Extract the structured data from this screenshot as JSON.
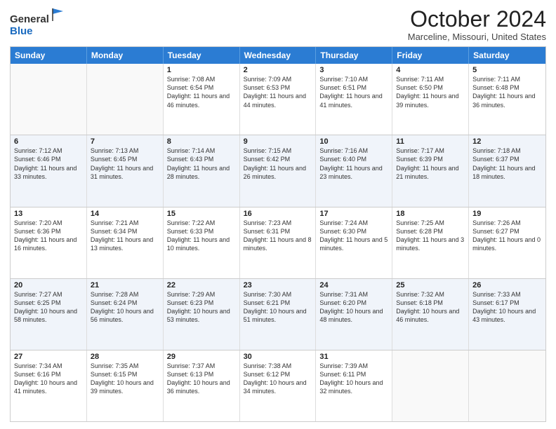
{
  "header": {
    "logo_line1": "General",
    "logo_line2": "Blue",
    "month_title": "October 2024",
    "location": "Marceline, Missouri, United States"
  },
  "weekdays": [
    "Sunday",
    "Monday",
    "Tuesday",
    "Wednesday",
    "Thursday",
    "Friday",
    "Saturday"
  ],
  "weeks": [
    [
      {
        "day": "",
        "info": "",
        "empty": true
      },
      {
        "day": "",
        "info": "",
        "empty": true
      },
      {
        "day": "1",
        "info": "Sunrise: 7:08 AM\nSunset: 6:54 PM\nDaylight: 11 hours and 46 minutes.",
        "empty": false
      },
      {
        "day": "2",
        "info": "Sunrise: 7:09 AM\nSunset: 6:53 PM\nDaylight: 11 hours and 44 minutes.",
        "empty": false
      },
      {
        "day": "3",
        "info": "Sunrise: 7:10 AM\nSunset: 6:51 PM\nDaylight: 11 hours and 41 minutes.",
        "empty": false
      },
      {
        "day": "4",
        "info": "Sunrise: 7:11 AM\nSunset: 6:50 PM\nDaylight: 11 hours and 39 minutes.",
        "empty": false
      },
      {
        "day": "5",
        "info": "Sunrise: 7:11 AM\nSunset: 6:48 PM\nDaylight: 11 hours and 36 minutes.",
        "empty": false
      }
    ],
    [
      {
        "day": "6",
        "info": "Sunrise: 7:12 AM\nSunset: 6:46 PM\nDaylight: 11 hours and 33 minutes.",
        "empty": false
      },
      {
        "day": "7",
        "info": "Sunrise: 7:13 AM\nSunset: 6:45 PM\nDaylight: 11 hours and 31 minutes.",
        "empty": false
      },
      {
        "day": "8",
        "info": "Sunrise: 7:14 AM\nSunset: 6:43 PM\nDaylight: 11 hours and 28 minutes.",
        "empty": false
      },
      {
        "day": "9",
        "info": "Sunrise: 7:15 AM\nSunset: 6:42 PM\nDaylight: 11 hours and 26 minutes.",
        "empty": false
      },
      {
        "day": "10",
        "info": "Sunrise: 7:16 AM\nSunset: 6:40 PM\nDaylight: 11 hours and 23 minutes.",
        "empty": false
      },
      {
        "day": "11",
        "info": "Sunrise: 7:17 AM\nSunset: 6:39 PM\nDaylight: 11 hours and 21 minutes.",
        "empty": false
      },
      {
        "day": "12",
        "info": "Sunrise: 7:18 AM\nSunset: 6:37 PM\nDaylight: 11 hours and 18 minutes.",
        "empty": false
      }
    ],
    [
      {
        "day": "13",
        "info": "Sunrise: 7:20 AM\nSunset: 6:36 PM\nDaylight: 11 hours and 16 minutes.",
        "empty": false
      },
      {
        "day": "14",
        "info": "Sunrise: 7:21 AM\nSunset: 6:34 PM\nDaylight: 11 hours and 13 minutes.",
        "empty": false
      },
      {
        "day": "15",
        "info": "Sunrise: 7:22 AM\nSunset: 6:33 PM\nDaylight: 11 hours and 10 minutes.",
        "empty": false
      },
      {
        "day": "16",
        "info": "Sunrise: 7:23 AM\nSunset: 6:31 PM\nDaylight: 11 hours and 8 minutes.",
        "empty": false
      },
      {
        "day": "17",
        "info": "Sunrise: 7:24 AM\nSunset: 6:30 PM\nDaylight: 11 hours and 5 minutes.",
        "empty": false
      },
      {
        "day": "18",
        "info": "Sunrise: 7:25 AM\nSunset: 6:28 PM\nDaylight: 11 hours and 3 minutes.",
        "empty": false
      },
      {
        "day": "19",
        "info": "Sunrise: 7:26 AM\nSunset: 6:27 PM\nDaylight: 11 hours and 0 minutes.",
        "empty": false
      }
    ],
    [
      {
        "day": "20",
        "info": "Sunrise: 7:27 AM\nSunset: 6:25 PM\nDaylight: 10 hours and 58 minutes.",
        "empty": false
      },
      {
        "day": "21",
        "info": "Sunrise: 7:28 AM\nSunset: 6:24 PM\nDaylight: 10 hours and 56 minutes.",
        "empty": false
      },
      {
        "day": "22",
        "info": "Sunrise: 7:29 AM\nSunset: 6:23 PM\nDaylight: 10 hours and 53 minutes.",
        "empty": false
      },
      {
        "day": "23",
        "info": "Sunrise: 7:30 AM\nSunset: 6:21 PM\nDaylight: 10 hours and 51 minutes.",
        "empty": false
      },
      {
        "day": "24",
        "info": "Sunrise: 7:31 AM\nSunset: 6:20 PM\nDaylight: 10 hours and 48 minutes.",
        "empty": false
      },
      {
        "day": "25",
        "info": "Sunrise: 7:32 AM\nSunset: 6:18 PM\nDaylight: 10 hours and 46 minutes.",
        "empty": false
      },
      {
        "day": "26",
        "info": "Sunrise: 7:33 AM\nSunset: 6:17 PM\nDaylight: 10 hours and 43 minutes.",
        "empty": false
      }
    ],
    [
      {
        "day": "27",
        "info": "Sunrise: 7:34 AM\nSunset: 6:16 PM\nDaylight: 10 hours and 41 minutes.",
        "empty": false
      },
      {
        "day": "28",
        "info": "Sunrise: 7:35 AM\nSunset: 6:15 PM\nDaylight: 10 hours and 39 minutes.",
        "empty": false
      },
      {
        "day": "29",
        "info": "Sunrise: 7:37 AM\nSunset: 6:13 PM\nDaylight: 10 hours and 36 minutes.",
        "empty": false
      },
      {
        "day": "30",
        "info": "Sunrise: 7:38 AM\nSunset: 6:12 PM\nDaylight: 10 hours and 34 minutes.",
        "empty": false
      },
      {
        "day": "31",
        "info": "Sunrise: 7:39 AM\nSunset: 6:11 PM\nDaylight: 10 hours and 32 minutes.",
        "empty": false
      },
      {
        "day": "",
        "info": "",
        "empty": true
      },
      {
        "day": "",
        "info": "",
        "empty": true
      }
    ]
  ]
}
